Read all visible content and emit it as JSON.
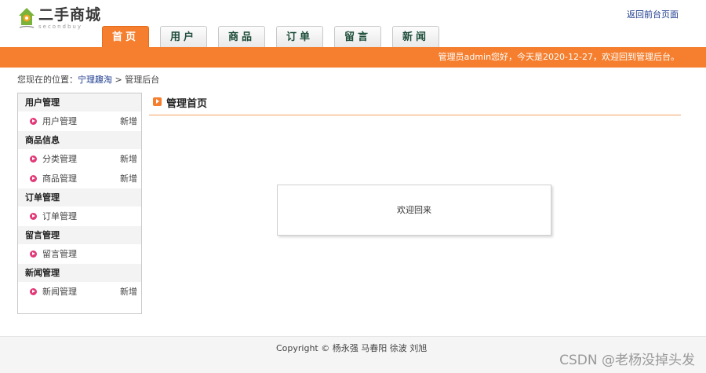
{
  "logo": {
    "title": "二手商城",
    "subtitle": "secondbuy"
  },
  "header": {
    "back_link": "返回前台页面"
  },
  "nav": {
    "tabs": [
      {
        "label": "首页",
        "active": true
      },
      {
        "label": "用户",
        "active": false
      },
      {
        "label": "商品",
        "active": false
      },
      {
        "label": "订单",
        "active": false
      },
      {
        "label": "留言",
        "active": false
      },
      {
        "label": "新闻",
        "active": false
      }
    ]
  },
  "greeting": "管理员admin您好，今天是2020-12-27，欢迎回到管理后台。",
  "breadcrumb": {
    "prefix": "您现在的位置：",
    "home": "宁理趣淘",
    "separator": " > ",
    "current": "管理后台"
  },
  "sidebar": {
    "groups": [
      {
        "title": "用户管理",
        "items": [
          {
            "label": "用户管理",
            "add": "新增"
          }
        ]
      },
      {
        "title": "商品信息",
        "items": [
          {
            "label": "分类管理",
            "add": "新增"
          },
          {
            "label": "商品管理",
            "add": "新增"
          }
        ]
      },
      {
        "title": "订单管理",
        "items": [
          {
            "label": "订单管理",
            "add": ""
          }
        ]
      },
      {
        "title": "留言管理",
        "items": [
          {
            "label": "留言管理",
            "add": ""
          }
        ]
      },
      {
        "title": "新闻管理",
        "items": [
          {
            "label": "新闻管理",
            "add": "新增"
          }
        ]
      }
    ]
  },
  "main": {
    "title": "管理首页",
    "welcome": "欢迎回来"
  },
  "footer": {
    "copyright": "Copyright © 杨永强 马春阳 徐波 刘旭"
  },
  "watermark": "CSDN @老杨没掉头发",
  "colors": {
    "accent": "#f57f2e",
    "link": "#1f3d8f",
    "bullet": "#e23a78"
  }
}
